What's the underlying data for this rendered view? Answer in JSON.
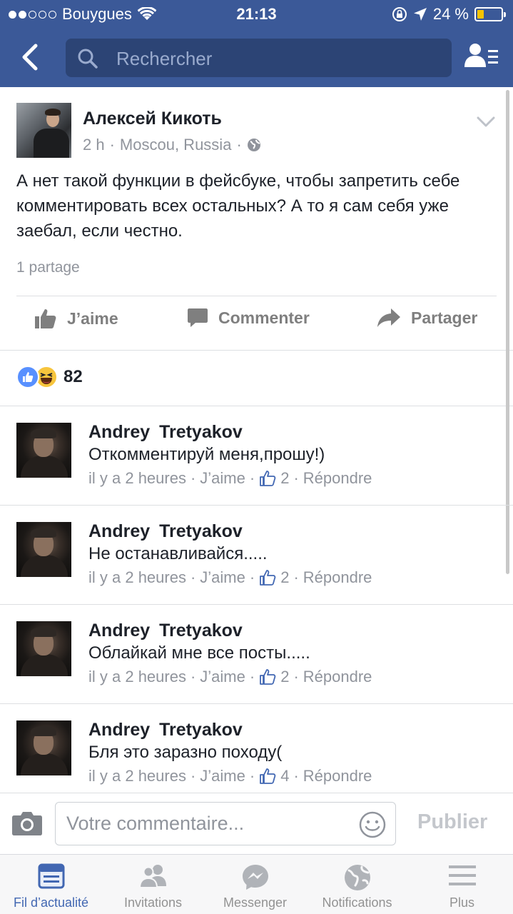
{
  "status_bar": {
    "carrier": "Bouygues",
    "time": "21:13",
    "battery": "24 %",
    "battery_level": 0.24
  },
  "header": {
    "search_placeholder": "Rechercher"
  },
  "post": {
    "author": "Алексей Кикоть",
    "time": "2 h",
    "location": "Moscou, Russia",
    "text": "А нет такой функции в фейсбуке, чтобы запретить себе комментировать всех остальных? А то я сам себя уже заебал, если честно.",
    "shares": "1 partage",
    "actions": {
      "like": "J’aime",
      "comment": "Commenter",
      "share": "Partager"
    },
    "reactions_count": "82"
  },
  "comments": [
    {
      "author": "Andrey Tretyakov",
      "text": "Откомментируй меня,прошу!)",
      "time": "il y a 2 heures",
      "like": "J’aime",
      "likes": "2",
      "reply": "Répondre"
    },
    {
      "author": "Andrey Tretyakov",
      "text": "Не останавливайся.....",
      "time": "il y a 2 heures",
      "like": "J’aime",
      "likes": "2",
      "reply": "Répondre"
    },
    {
      "author": "Andrey Tretyakov",
      "text": "Облайкай мне все посты.....",
      "time": "il y a 2 heures",
      "like": "J’aime",
      "likes": "2",
      "reply": "Répondre"
    },
    {
      "author": "Andrey Tretyakov",
      "text": "Бля это заразно походу(",
      "time": "il y a 2 heures",
      "like": "J’aime",
      "likes": "4",
      "reply": "Répondre"
    }
  ],
  "composer": {
    "placeholder": "Votre commentaire...",
    "publish": "Publier"
  },
  "tabs": [
    {
      "label": "Fil d’actualité",
      "icon": "news-feed-icon",
      "active": true
    },
    {
      "label": "Invitations",
      "icon": "friends-icon",
      "active": false
    },
    {
      "label": "Messenger",
      "icon": "messenger-icon",
      "active": false
    },
    {
      "label": "Notifications",
      "icon": "globe-icon",
      "active": false
    },
    {
      "label": "Plus",
      "icon": "menu-icon",
      "active": false
    }
  ],
  "colors": {
    "brand": "#3b5998",
    "active_tab": "#4267b2",
    "secondary_text": "#90949c",
    "like_reaction": "#5890ff",
    "haha_reaction": "#f7c53d"
  }
}
